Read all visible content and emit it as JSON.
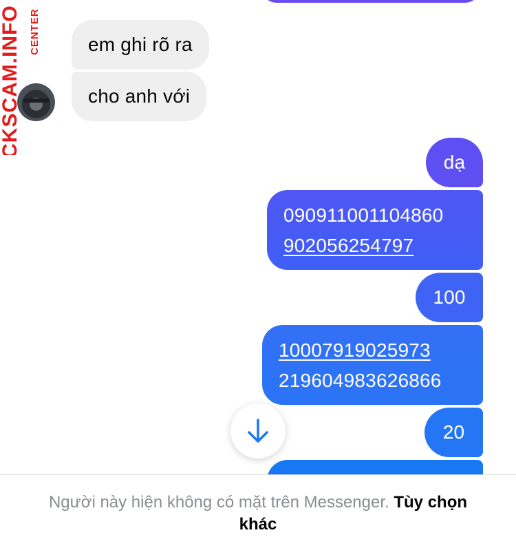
{
  "watermark": {
    "main": "CKSCAM.INFO",
    "sub": "CENTER"
  },
  "received": [
    {
      "text": "em ghi rõ ra"
    },
    {
      "text": "cho anh với"
    }
  ],
  "sent": [
    {
      "lines": [
        "dạ"
      ]
    },
    {
      "lines": [
        "090911001104860",
        "902056254797"
      ]
    },
    {
      "lines": [
        "100"
      ]
    },
    {
      "lines": [
        "10007919025973",
        "219604983626866"
      ]
    },
    {
      "lines": [
        "20"
      ]
    }
  ],
  "scroll_button": {
    "icon": "arrow-down-icon"
  },
  "footer": {
    "message": "Người này hiện không có mặt trên Messenger.",
    "link": "Tùy chọn khác"
  },
  "colors": {
    "received_bubble": "#efefef",
    "sent_top": "#6a4bf0",
    "sent_bottom": "#1877f2",
    "watermark": "#e21b1b"
  }
}
